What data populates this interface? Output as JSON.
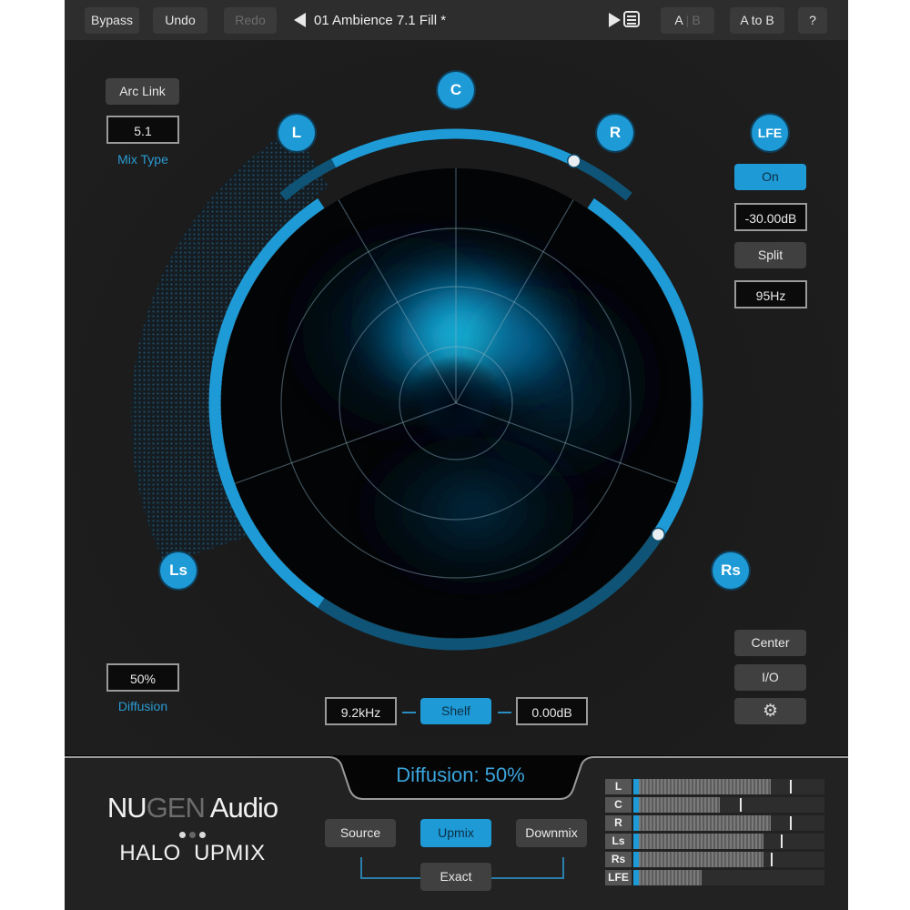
{
  "topbar": {
    "bypass": "Bypass",
    "undo": "Undo",
    "redo": "Redo",
    "prev_icon": "triangle-left-icon",
    "preset_name": "01 Ambience 7.1 Fill *",
    "next_icon": "triangle-right-icon",
    "preset_list_icon": "list-icon",
    "ab_a": "A",
    "ab_sep": "|",
    "ab_b": "B",
    "a_to_b": "A to B",
    "help": "?"
  },
  "left_panel": {
    "arc_link": "Arc Link",
    "mix_type_value": "5.1",
    "mix_type_label": "Mix Type",
    "diffusion_value": "50%",
    "diffusion_label": "Diffusion"
  },
  "speakers": {
    "c": "C",
    "l": "L",
    "r": "R",
    "ls": "Ls",
    "rs": "Rs"
  },
  "lfe_panel": {
    "lfe": "LFE",
    "on": "On",
    "gain": "-30.00dB",
    "split": "Split",
    "freq": "95Hz"
  },
  "right_lower": {
    "center": "Center",
    "io": "I/O",
    "settings_icon": "gear-icon"
  },
  "shelf": {
    "freq": "9.2kHz",
    "shelf": "Shelf",
    "gain": "0.00dB"
  },
  "bottom": {
    "diffusion_readout": "Diffusion: 50%",
    "logo_nu": "NU",
    "logo_gen": "GEN",
    "logo_audio": " Audio",
    "product": "HALO  UPMIX",
    "modes": {
      "source": "Source",
      "upmix": "Upmix",
      "downmix": "Downmix",
      "exact": "Exact"
    },
    "active_mode": "Upmix"
  },
  "meters": [
    {
      "label": "L",
      "level": 0.72,
      "peak": 0.82
    },
    {
      "label": "C",
      "level": 0.44,
      "peak": 0.55
    },
    {
      "label": "R",
      "level": 0.72,
      "peak": 0.82
    },
    {
      "label": "Ls",
      "level": 0.68,
      "peak": 0.77
    },
    {
      "label": "Rs",
      "level": 0.68,
      "peak": 0.72
    },
    {
      "label": "LFE",
      "level": 0.34,
      "peak": null
    }
  ],
  "colors": {
    "accent": "#1e9ad6",
    "accent_dark": "#0f5476",
    "label_blue": "#2a9bd3",
    "panel": "#1e1e1e"
  }
}
